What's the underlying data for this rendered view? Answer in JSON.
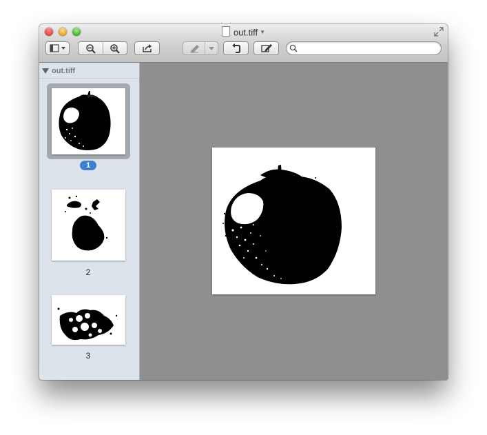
{
  "window": {
    "title": "out.tiff",
    "file_icon": "document-icon"
  },
  "toolbar": {
    "buttons": [
      {
        "name": "sidebar-toggle",
        "icon": "sidebar-icon"
      },
      {
        "name": "zoom-out",
        "icon": "zoom-out-icon"
      },
      {
        "name": "zoom-in",
        "icon": "zoom-in-icon"
      },
      {
        "name": "share",
        "icon": "share-icon"
      },
      {
        "name": "markup",
        "icon": "pen-icon",
        "enabled": false
      },
      {
        "name": "rotate",
        "icon": "rotate-left-icon"
      },
      {
        "name": "edit",
        "icon": "edit-icon"
      }
    ],
    "search": {
      "value": "",
      "placeholder": ""
    }
  },
  "sidebar": {
    "header": "out.tiff",
    "pages": [
      {
        "label": "1",
        "selected": true
      },
      {
        "label": "2",
        "selected": false
      },
      {
        "label": "3",
        "selected": false
      }
    ]
  },
  "colors": {
    "selection_badge": "#3f7fd2",
    "content_background": "#8f8f8f",
    "sidebar_background": "#dde3ea"
  }
}
